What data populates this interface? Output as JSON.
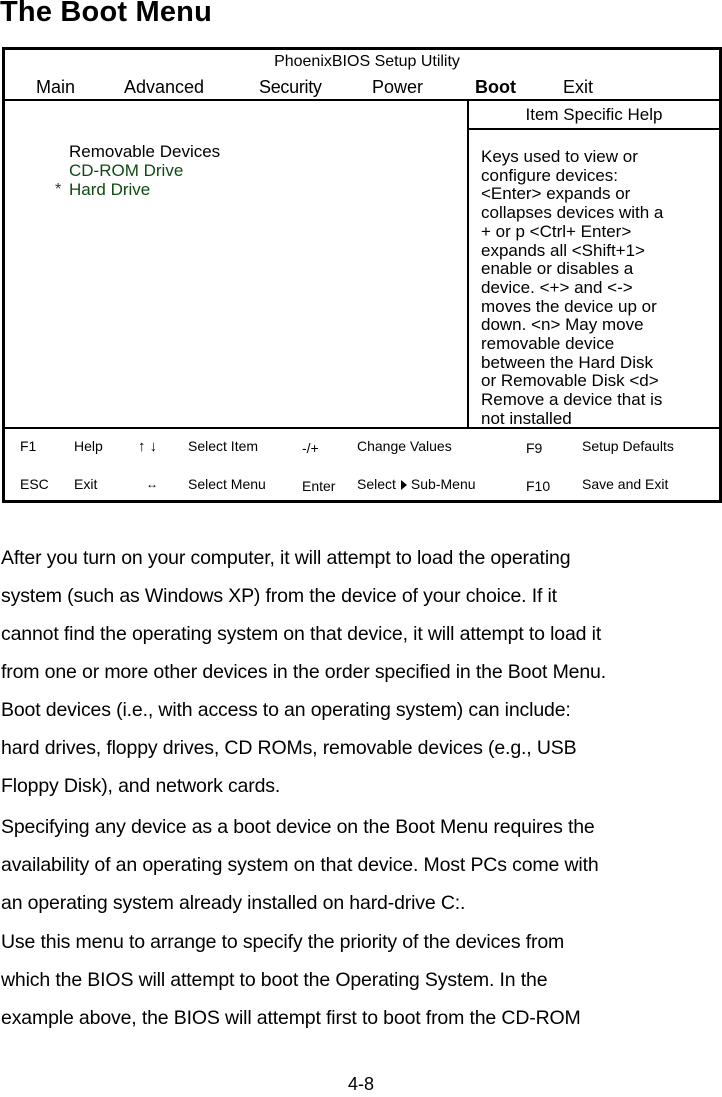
{
  "heading": "The Boot Menu",
  "bios": {
    "title": "PhoenixBIOS Setup Utility",
    "menu": [
      {
        "label": "Main",
        "active": false
      },
      {
        "label": "Advanced",
        "active": false
      },
      {
        "label": "Security",
        "active": false
      },
      {
        "label": "Power",
        "active": false
      },
      {
        "label": "Boot",
        "active": true
      },
      {
        "label": "Exit",
        "active": false
      }
    ],
    "boot_list": {
      "group": "Removable Devices",
      "devices": [
        {
          "label": "CD-ROM Drive",
          "marker": ""
        },
        {
          "label": "Hard Drive",
          "marker": "*"
        }
      ],
      "device_color": "#0f4a12"
    },
    "help": {
      "header": "Item Specific Help",
      "lines": [
        "Keys used to view or",
        "configure devices:",
        "<Enter> expands or",
        "collapses devices with a",
        "+ or p <Ctrl+ Enter>",
        "expands all <Shift+1>",
        "enable or disables a",
        "device. <+> and <->",
        "moves the device up or",
        "down. <n> May move",
        "removable device",
        "between the Hard Disk",
        "or Removable Disk <d>",
        "Remove a device that is",
        "not installed"
      ]
    },
    "footer": {
      "row1": [
        {
          "key": "F1",
          "action": "Help"
        },
        {
          "key": "↑ ↓",
          "action": "Select Item"
        },
        {
          "key": "-/+",
          "action": "Change Values"
        },
        {
          "key": "F9",
          "action": "Setup Defaults"
        }
      ],
      "row2": [
        {
          "key": "ESC",
          "action": "Exit"
        },
        {
          "key": "↔",
          "action": "Select Menu"
        },
        {
          "key": "Enter",
          "action_pre": "Select",
          "action_post": "Sub-Menu"
        },
        {
          "key": "F10",
          "action": "Save and Exit"
        }
      ]
    }
  },
  "body": {
    "paragraphs": [
      {
        "lines": [
          "After you turn on your computer, it will attempt to load the operating",
          "system (such as Windows XP) from the device of your choice. If it",
          "cannot find the operating system on that device, it will attempt to load it",
          "from one or more other devices in the order specified in the Boot Menu.",
          "Boot devices (i.e., with access to an operating system) can include:",
          "hard drives, floppy drives, CD ROMs, removable devices (e.g., USB",
          "Floppy Disk), and network cards."
        ]
      },
      {
        "lines": [
          "Specifying any device as a boot device on the Boot Menu requires the",
          "availability of an operating system on that device. Most PCs come with",
          "an operating system already installed on hard-drive C:."
        ]
      },
      {
        "lines": [
          "Use this menu to arrange to specify the priority of the devices from",
          "which the BIOS will attempt to boot the Operating System. In the",
          "example above, the BIOS will attempt first to boot from the CD-ROM"
        ]
      }
    ]
  },
  "page_number": "4-8"
}
